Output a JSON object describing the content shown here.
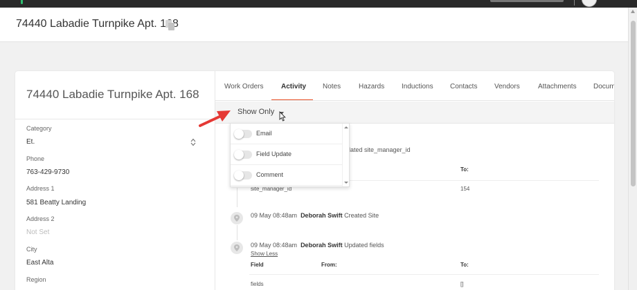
{
  "header": {
    "title": "74440 Labadie Turnpike Apt. 168"
  },
  "sidebar": {
    "title": "74440 Labadie Turnpike Apt. 168",
    "fields": [
      {
        "label": "Category",
        "value": "Et."
      },
      {
        "label": "Phone",
        "value": "763-429-9730"
      },
      {
        "label": "Address 1",
        "value": "581 Beatty Landing"
      },
      {
        "label": "Address 2",
        "value": "Not Set"
      },
      {
        "label": "City",
        "value": "East Alta"
      },
      {
        "label": "Region",
        "value": ""
      }
    ]
  },
  "tabs": [
    {
      "label": "Work Orders",
      "active": false
    },
    {
      "label": "Activity",
      "active": true
    },
    {
      "label": "Notes",
      "active": false
    },
    {
      "label": "Hazards",
      "active": false
    },
    {
      "label": "Inductions",
      "active": false
    },
    {
      "label": "Contacts",
      "active": false
    },
    {
      "label": "Vendors",
      "active": false
    },
    {
      "label": "Attachments",
      "active": false
    },
    {
      "label": "Docum",
      "active": false
    }
  ],
  "filter": {
    "label": "Show Only",
    "options": [
      {
        "label": "Email",
        "on": false
      },
      {
        "label": "Field Update",
        "on": false
      },
      {
        "label": "Comment",
        "on": false
      }
    ]
  },
  "activity": {
    "entry1": {
      "action_partial": "pdated site_manager_id",
      "to_header": "To:",
      "field_value": "site_manager_id",
      "to_value": "154"
    },
    "entry2": {
      "time": "09 May 08:48am",
      "user": "Deborah Swift",
      "action": "Created Site"
    },
    "entry3": {
      "time": "09 May 08:48am",
      "user": "Deborah Swift",
      "action": "Updated fields",
      "show_less": "Show Less",
      "headers": {
        "field": "Field",
        "from": "From:",
        "to": "To:"
      },
      "row": {
        "field": "fields",
        "from": "",
        "to": "[]"
      }
    }
  },
  "colors": {
    "accent": "#e84e24",
    "arrow": "#e53935",
    "topbar": "#2a2a2a"
  },
  "icons": [
    "copy-icon",
    "up-down-icon",
    "map-pin-icon",
    "arrow-annotation",
    "cursor-icon"
  ]
}
